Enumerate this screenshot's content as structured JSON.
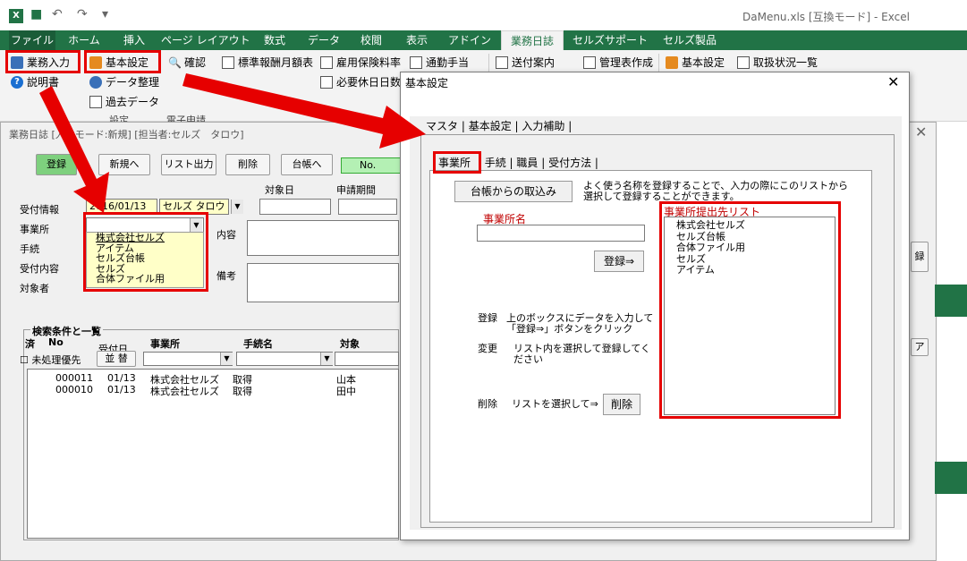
{
  "window": {
    "title": "DaMenu.xls [互換モード] - Excel"
  },
  "ribbon": {
    "tabs": [
      "ファイル",
      "ホーム",
      "挿入",
      "ページ レイアウト",
      "数式",
      "データ",
      "校閲",
      "表示",
      "アドイン",
      "業務日誌",
      "セルズサポート",
      "セルズ製品"
    ],
    "active_tab": "業務日誌",
    "buttons": {
      "gyomu_nyuryoku": "業務入力",
      "kihon_settei": "基本設定",
      "kakunin": "確認",
      "hyojun": "標準報酬月額表",
      "koyo": "雇用保険料率",
      "tsukin": "通勤手当",
      "sofu": "送付案内",
      "kanri": "管理表作成",
      "kihon_settei2": "基本設定",
      "torihiki": "取扱状況一覧",
      "setsumei": "説明書",
      "data_seiri": "データ整理",
      "kako_data": "過去データ",
      "hitsuyo": "必要休日日数",
      "settei_group": "設定",
      "denshi": "電子申請"
    }
  },
  "form": {
    "title": "業務日誌 [入力モード:新規] [担当者:セルズ　タロウ]",
    "buttons": {
      "register": "登録",
      "new": "新規へ",
      "list_out": "リスト出力",
      "delete": "削除",
      "ledger": "台帳へ"
    },
    "no_label": "No.",
    "labels": {
      "uketsuke": "受付情報",
      "jigyosho": "事業所",
      "tetsuzuki": "手続",
      "naiyo": "受付内容",
      "taisho": "対象者",
      "content": "内容",
      "biko": "備考",
      "taishobi": "対象日",
      "shinsei": "申請期間"
    },
    "uketsuke_date": "2016/01/13",
    "uketsuke_person": "セルズ タロウ",
    "jigyosho_options": [
      "株式会社セルズ",
      "アイテム",
      "セルズ台帳",
      "セルズ",
      "合体ファイル用"
    ],
    "search": {
      "title": "検索条件と一覧",
      "cols": {
        "sumi": "済",
        "no": "No",
        "uketsuke_date": "受付日",
        "sort": "並 替",
        "jigyosho": "事業所",
        "tetsuzuki": "手続名",
        "taisho": "対象"
      },
      "unprocessed": "未処理優先",
      "rows": [
        {
          "no": "000011",
          "date": "01/13",
          "company": "株式会社セルズ",
          "proc": "取得",
          "target": "山本"
        },
        {
          "no": "000010",
          "date": "01/13",
          "company": "株式会社セルズ",
          "proc": "取得",
          "target": "田中"
        }
      ]
    }
  },
  "dialog": {
    "title": "基本設定",
    "tabs": [
      "マスタ",
      "基本設定",
      "入力補助"
    ],
    "sub_tabs": [
      "事業所",
      "手続",
      "職員",
      "受付方法"
    ],
    "import_button": "台帳からの取込み",
    "info_line1": "よく使う名称を登録することで、入力の際にこのリストから",
    "info_line2": "選択して登録することができます。",
    "field_label": "事業所名",
    "register_button": "登録⇒",
    "list_title": "事業所提出先リスト",
    "list_items": [
      "株式会社セルズ",
      "セルズ台帳",
      "合体ファイル用",
      "セルズ",
      "アイテム"
    ],
    "help": {
      "register_label": "登録",
      "register_line1": "上のボックスにデータを入力して",
      "register_line2": "「登録⇒」ボタンをクリック",
      "change_label": "変更",
      "change_line1": "リスト内を選択して登録してく",
      "change_line2": "ださい",
      "delete_label": "削除",
      "delete_text": "リストを選択して⇒"
    },
    "delete_button": "削除"
  },
  "colors": {
    "excel_green": "#217346",
    "highlight_red": "#e60000"
  }
}
